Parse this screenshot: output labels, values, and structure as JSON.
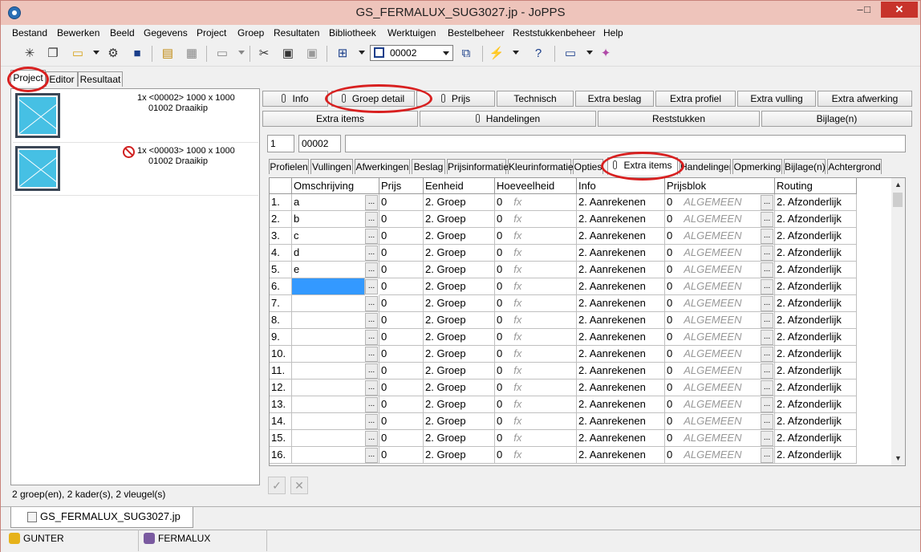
{
  "window": {
    "title": "GS_FERMALUX_SUG3027.jp - JoPPS",
    "min": "–",
    "max": "□",
    "close": "✕"
  },
  "menu": [
    "Bestand",
    "Bewerken",
    "Beeld",
    "Gegevens",
    "Project",
    "Groep",
    "Resultaten",
    "Bibliotheek",
    "Werktuigen",
    "Bestelbeheer",
    "Reststukkenbeheer",
    "Help"
  ],
  "toolbar": {
    "combo_value": "00002",
    "icons": [
      "new-icon",
      "copy-icon",
      "open-folder-icon",
      "settings-icon",
      "save-icon",
      "print-preview-icon",
      "table-icon",
      "print-icon",
      "cut-icon",
      "paste-icon",
      "paste-special-icon",
      "grid-select-icon",
      "frame-icon",
      "multi-frame-icon",
      "lightning-icon",
      "database-help-icon",
      "report-icon",
      "wizard-icon"
    ]
  },
  "left_tabs": [
    "Project",
    "Editor",
    "Resultaat"
  ],
  "project_items": [
    {
      "line1": "1x <00002> 1000 x 1000",
      "line2": "01002 Draaikip",
      "blocked": false
    },
    {
      "line1": "1x <00003> 1000 x 1000",
      "line2": "01002 Draaikip",
      "blocked": true
    }
  ],
  "left_status": "2 groep(en), 2 kader(s), 2 vleugel(s)",
  "top_buttons": {
    "row1": [
      "Info",
      "Groep detail",
      "Prijs",
      "Technisch",
      "Extra beslag",
      "Extra profiel",
      "Extra vulling",
      "Extra afwerking"
    ],
    "row2": [
      "Extra items",
      "Handelingen",
      "Reststukken",
      "Bijlage(n)"
    ]
  },
  "fields": {
    "nr": "1",
    "code": "00002",
    "desc": ""
  },
  "sub_tabs": [
    "Profielen",
    "Vullingen",
    "Afwerkingen",
    "Beslag",
    "Prijsinformatie",
    "Kleurinformatie",
    "Opties",
    "Extra items",
    "Handelingen",
    "Opmerking",
    "Bijlage(n)",
    "Achtergrond"
  ],
  "grid": {
    "headers": [
      "Omschrijving",
      "Prijs",
      "Eenheid",
      "Hoeveelheid",
      "Info",
      "Prijsblok",
      "Routing"
    ],
    "rows": [
      {
        "nr": "1.",
        "omschrijving": "a",
        "prijs": "0",
        "eenheid": "2. Groep",
        "hoeveelheid": "0",
        "formula": "fx",
        "info": "2. Aanrekenen",
        "prijsblok_val": "0",
        "prijsblok": "ALGEMEEN",
        "routing": "2. Afzonderlijk"
      },
      {
        "nr": "2.",
        "omschrijving": "b",
        "prijs": "0",
        "eenheid": "2. Groep",
        "hoeveelheid": "0",
        "formula": "fx",
        "info": "2. Aanrekenen",
        "prijsblok_val": "0",
        "prijsblok": "ALGEMEEN",
        "routing": "2. Afzonderlijk"
      },
      {
        "nr": "3.",
        "omschrijving": "c",
        "prijs": "0",
        "eenheid": "2. Groep",
        "hoeveelheid": "0",
        "formula": "fx",
        "info": "2. Aanrekenen",
        "prijsblok_val": "0",
        "prijsblok": "ALGEMEEN",
        "routing": "2. Afzonderlijk"
      },
      {
        "nr": "4.",
        "omschrijving": "d",
        "prijs": "0",
        "eenheid": "2. Groep",
        "hoeveelheid": "0",
        "formula": "fx",
        "info": "2. Aanrekenen",
        "prijsblok_val": "0",
        "prijsblok": "ALGEMEEN",
        "routing": "2. Afzonderlijk"
      },
      {
        "nr": "5.",
        "omschrijving": "e",
        "prijs": "0",
        "eenheid": "2. Groep",
        "hoeveelheid": "0",
        "formula": "fx",
        "info": "2. Aanrekenen",
        "prijsblok_val": "0",
        "prijsblok": "ALGEMEEN",
        "routing": "2. Afzonderlijk"
      },
      {
        "nr": "6.",
        "omschrijving": "",
        "prijs": "0",
        "eenheid": "2. Groep",
        "hoeveelheid": "0",
        "formula": "fx",
        "info": "2. Aanrekenen",
        "prijsblok_val": "0",
        "prijsblok": "ALGEMEEN",
        "routing": "2. Afzonderlijk"
      },
      {
        "nr": "7.",
        "omschrijving": "",
        "prijs": "0",
        "eenheid": "2. Groep",
        "hoeveelheid": "0",
        "formula": "fx",
        "info": "2. Aanrekenen",
        "prijsblok_val": "0",
        "prijsblok": "ALGEMEEN",
        "routing": "2. Afzonderlijk"
      },
      {
        "nr": "8.",
        "omschrijving": "",
        "prijs": "0",
        "eenheid": "2. Groep",
        "hoeveelheid": "0",
        "formula": "fx",
        "info": "2. Aanrekenen",
        "prijsblok_val": "0",
        "prijsblok": "ALGEMEEN",
        "routing": "2. Afzonderlijk"
      },
      {
        "nr": "9.",
        "omschrijving": "",
        "prijs": "0",
        "eenheid": "2. Groep",
        "hoeveelheid": "0",
        "formula": "fx",
        "info": "2. Aanrekenen",
        "prijsblok_val": "0",
        "prijsblok": "ALGEMEEN",
        "routing": "2. Afzonderlijk"
      },
      {
        "nr": "10.",
        "omschrijving": "",
        "prijs": "0",
        "eenheid": "2. Groep",
        "hoeveelheid": "0",
        "formula": "fx",
        "info": "2. Aanrekenen",
        "prijsblok_val": "0",
        "prijsblok": "ALGEMEEN",
        "routing": "2. Afzonderlijk"
      },
      {
        "nr": "11.",
        "omschrijving": "",
        "prijs": "0",
        "eenheid": "2. Groep",
        "hoeveelheid": "0",
        "formula": "fx",
        "info": "2. Aanrekenen",
        "prijsblok_val": "0",
        "prijsblok": "ALGEMEEN",
        "routing": "2. Afzonderlijk"
      },
      {
        "nr": "12.",
        "omschrijving": "",
        "prijs": "0",
        "eenheid": "2. Groep",
        "hoeveelheid": "0",
        "formula": "fx",
        "info": "2. Aanrekenen",
        "prijsblok_val": "0",
        "prijsblok": "ALGEMEEN",
        "routing": "2. Afzonderlijk"
      },
      {
        "nr": "13.",
        "omschrijving": "",
        "prijs": "0",
        "eenheid": "2. Groep",
        "hoeveelheid": "0",
        "formula": "fx",
        "info": "2. Aanrekenen",
        "prijsblok_val": "0",
        "prijsblok": "ALGEMEEN",
        "routing": "2. Afzonderlijk"
      },
      {
        "nr": "14.",
        "omschrijving": "",
        "prijs": "0",
        "eenheid": "2. Groep",
        "hoeveelheid": "0",
        "formula": "fx",
        "info": "2. Aanrekenen",
        "prijsblok_val": "0",
        "prijsblok": "ALGEMEEN",
        "routing": "2. Afzonderlijk"
      },
      {
        "nr": "15.",
        "omschrijving": "",
        "prijs": "0",
        "eenheid": "2. Groep",
        "hoeveelheid": "0",
        "formula": "fx",
        "info": "2. Aanrekenen",
        "prijsblok_val": "0",
        "prijsblok": "ALGEMEEN",
        "routing": "2. Afzonderlijk"
      },
      {
        "nr": "16.",
        "omschrijving": "",
        "prijs": "0",
        "eenheid": "2. Groep",
        "hoeveelheid": "0",
        "formula": "fx",
        "info": "2. Aanrekenen",
        "prijsblok_val": "0",
        "prijsblok": "ALGEMEEN",
        "routing": "2. Afzonderlijk"
      }
    ],
    "selected_row": 5,
    "ellipsis": "..."
  },
  "actions": {
    "confirm": "✓",
    "cancel": "✕"
  },
  "document_tab": "GS_FERMALUX_SUG3027.jp",
  "status": {
    "user": "GUNTER",
    "database": "FERMALUX"
  },
  "colors": {
    "titlebar": "#eec4bb",
    "selection": "#3399ff",
    "highlight_circle": "#d82020",
    "close_button": "#c7332b"
  }
}
